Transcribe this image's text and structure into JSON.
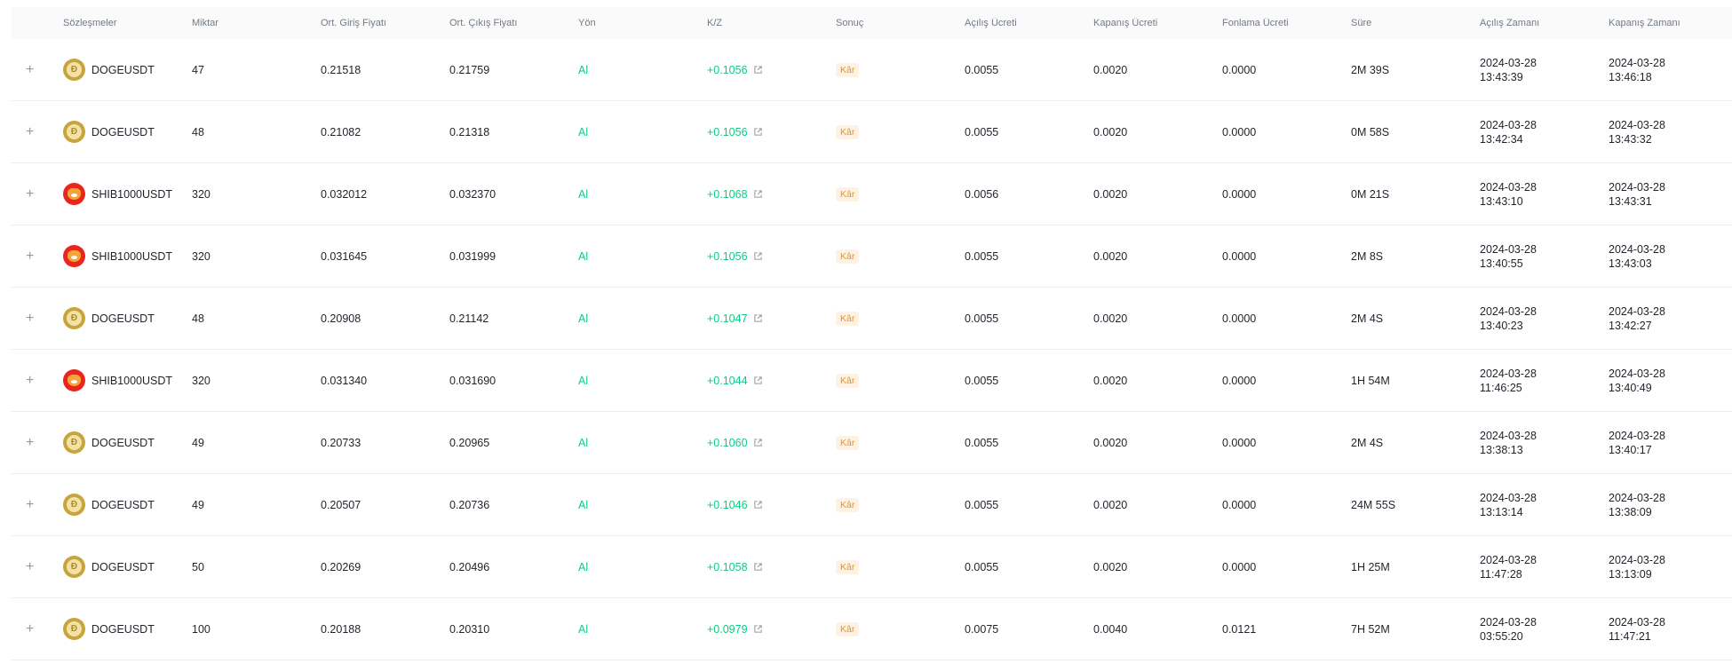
{
  "colors": {
    "profit": "#0ecb81",
    "badge_bg": "#fdf2e4",
    "badge_text": "#f0920f",
    "header_bg": "#fafafa"
  },
  "headers": [
    "",
    "Sözleşmeler",
    "Miktar",
    "Ort. Giriş Fiyatı",
    "Ort. Çıkış Fiyatı",
    "Yön",
    "K/Z",
    "Sonuç",
    "Açılış Ücreti",
    "Kapanış Ücreti",
    "Fonlama Ücreti",
    "Süre",
    "Açılış Zamanı",
    "Kapanış Zamanı"
  ],
  "rows": [
    {
      "coin": "doge",
      "symbol": "DOGEUSDT",
      "qty": "47",
      "entry": "0.21518",
      "exit": "0.21759",
      "dir": "Al",
      "pnl": "+0.1056",
      "result": "Kâr",
      "open_fee": "0.0055",
      "close_fee": "0.0020",
      "funding": "0.0000",
      "duration": "2M 39S",
      "open_date": "2024-03-28",
      "open_time": "13:43:39",
      "close_date": "2024-03-28",
      "close_time": "13:46:18"
    },
    {
      "coin": "doge",
      "symbol": "DOGEUSDT",
      "qty": "48",
      "entry": "0.21082",
      "exit": "0.21318",
      "dir": "Al",
      "pnl": "+0.1056",
      "result": "Kâr",
      "open_fee": "0.0055",
      "close_fee": "0.0020",
      "funding": "0.0000",
      "duration": "0M 58S",
      "open_date": "2024-03-28",
      "open_time": "13:42:34",
      "close_date": "2024-03-28",
      "close_time": "13:43:32"
    },
    {
      "coin": "shib",
      "symbol": "SHIB1000USDT",
      "qty": "320",
      "entry": "0.032012",
      "exit": "0.032370",
      "dir": "Al",
      "pnl": "+0.1068",
      "result": "Kâr",
      "open_fee": "0.0056",
      "close_fee": "0.0020",
      "funding": "0.0000",
      "duration": "0M 21S",
      "open_date": "2024-03-28",
      "open_time": "13:43:10",
      "close_date": "2024-03-28",
      "close_time": "13:43:31"
    },
    {
      "coin": "shib",
      "symbol": "SHIB1000USDT",
      "qty": "320",
      "entry": "0.031645",
      "exit": "0.031999",
      "dir": "Al",
      "pnl": "+0.1056",
      "result": "Kâr",
      "open_fee": "0.0055",
      "close_fee": "0.0020",
      "funding": "0.0000",
      "duration": "2M 8S",
      "open_date": "2024-03-28",
      "open_time": "13:40:55",
      "close_date": "2024-03-28",
      "close_time": "13:43:03"
    },
    {
      "coin": "doge",
      "symbol": "DOGEUSDT",
      "qty": "48",
      "entry": "0.20908",
      "exit": "0.21142",
      "dir": "Al",
      "pnl": "+0.1047",
      "result": "Kâr",
      "open_fee": "0.0055",
      "close_fee": "0.0020",
      "funding": "0.0000",
      "duration": "2M 4S",
      "open_date": "2024-03-28",
      "open_time": "13:40:23",
      "close_date": "2024-03-28",
      "close_time": "13:42:27"
    },
    {
      "coin": "shib",
      "symbol": "SHIB1000USDT",
      "qty": "320",
      "entry": "0.031340",
      "exit": "0.031690",
      "dir": "Al",
      "pnl": "+0.1044",
      "result": "Kâr",
      "open_fee": "0.0055",
      "close_fee": "0.0020",
      "funding": "0.0000",
      "duration": "1H 54M",
      "open_date": "2024-03-28",
      "open_time": "11:46:25",
      "close_date": "2024-03-28",
      "close_time": "13:40:49"
    },
    {
      "coin": "doge",
      "symbol": "DOGEUSDT",
      "qty": "49",
      "entry": "0.20733",
      "exit": "0.20965",
      "dir": "Al",
      "pnl": "+0.1060",
      "result": "Kâr",
      "open_fee": "0.0055",
      "close_fee": "0.0020",
      "funding": "0.0000",
      "duration": "2M 4S",
      "open_date": "2024-03-28",
      "open_time": "13:38:13",
      "close_date": "2024-03-28",
      "close_time": "13:40:17"
    },
    {
      "coin": "doge",
      "symbol": "DOGEUSDT",
      "qty": "49",
      "entry": "0.20507",
      "exit": "0.20736",
      "dir": "Al",
      "pnl": "+0.1046",
      "result": "Kâr",
      "open_fee": "0.0055",
      "close_fee": "0.0020",
      "funding": "0.0000",
      "duration": "24M 55S",
      "open_date": "2024-03-28",
      "open_time": "13:13:14",
      "close_date": "2024-03-28",
      "close_time": "13:38:09"
    },
    {
      "coin": "doge",
      "symbol": "DOGEUSDT",
      "qty": "50",
      "entry": "0.20269",
      "exit": "0.20496",
      "dir": "Al",
      "pnl": "+0.1058",
      "result": "Kâr",
      "open_fee": "0.0055",
      "close_fee": "0.0020",
      "funding": "0.0000",
      "duration": "1H 25M",
      "open_date": "2024-03-28",
      "open_time": "11:47:28",
      "close_date": "2024-03-28",
      "close_time": "13:13:09"
    },
    {
      "coin": "doge",
      "symbol": "DOGEUSDT",
      "qty": "100",
      "entry": "0.20188",
      "exit": "0.20310",
      "dir": "Al",
      "pnl": "+0.0979",
      "result": "Kâr",
      "open_fee": "0.0075",
      "close_fee": "0.0040",
      "funding": "0.0121",
      "duration": "7H 52M",
      "open_date": "2024-03-28",
      "open_time": "03:55:20",
      "close_date": "2024-03-28",
      "close_time": "11:47:21"
    }
  ]
}
